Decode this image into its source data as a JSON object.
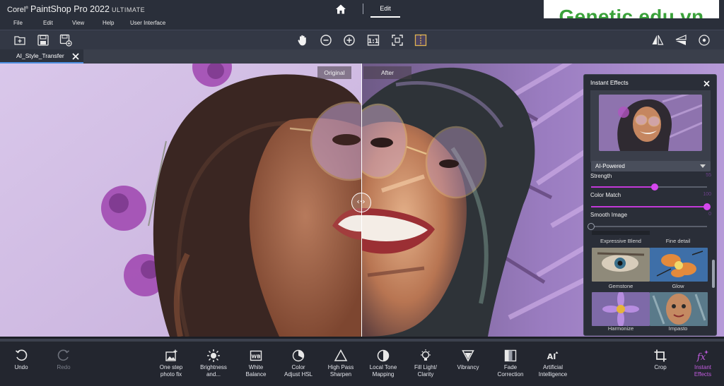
{
  "app": {
    "brand": "Corel",
    "product": "PaintShop Pro 2022",
    "edition": "ULTIMATE",
    "mode_tab": "Edit"
  },
  "watermark": "Genetic.edu.vn",
  "menu": [
    "File",
    "Edit",
    "View",
    "Help",
    "User Interface"
  ],
  "toolbar": {
    "left_icons": [
      "new-file-icon",
      "save-icon",
      "save-as-icon"
    ],
    "center_icons": [
      "pan-hand-icon",
      "zoom-out-icon",
      "zoom-in-icon",
      "actual-size-icon",
      "fit-to-window-icon",
      "compare-split-icon"
    ],
    "right_icons": [
      "flip-horizontal-icon",
      "flip-vertical-icon",
      "more-options-icon"
    ]
  },
  "document_tab": {
    "name": "AI_Style_Transfer"
  },
  "compare": {
    "original_label": "Original",
    "after_label": "After",
    "handle_glyph": "‹·›"
  },
  "panel": {
    "title": "Instant Effects",
    "dropdown": "AI-Powered",
    "sliders": [
      {
        "label": "Strength",
        "value": 55,
        "max": 100
      },
      {
        "label": "Color Match",
        "value": 100,
        "max": 100
      },
      {
        "label": "Smooth Image",
        "value": 0,
        "max": 100
      }
    ],
    "effects": [
      "Expressive Blend",
      "Fine detail",
      "Gemstone",
      "Glow",
      "Harmonize",
      "Impasto"
    ]
  },
  "dock": [
    {
      "label": "Undo",
      "icon": "undo-icon",
      "enabled": true
    },
    {
      "label": "Redo",
      "icon": "redo-icon",
      "enabled": false
    },
    {
      "label": "One step\nphoto fix",
      "icon": "one-step-fix-icon",
      "enabled": true
    },
    {
      "label": "Brightness\nand...",
      "icon": "brightness-icon",
      "enabled": true
    },
    {
      "label": "White\nBalance",
      "icon": "white-balance-icon",
      "enabled": true
    },
    {
      "label": "Color\nAdjust HSL",
      "icon": "color-hsl-icon",
      "enabled": true
    },
    {
      "label": "High Pass\nSharpen",
      "icon": "high-pass-icon",
      "enabled": true
    },
    {
      "label": "Local Tone\nMapping",
      "icon": "tone-mapping-icon",
      "enabled": true
    },
    {
      "label": "Fill Light/\nClarity",
      "icon": "fill-light-icon",
      "enabled": true
    },
    {
      "label": "Vibrancy",
      "icon": "vibrancy-icon",
      "enabled": true
    },
    {
      "label": "Fade\nCorrection",
      "icon": "fade-correction-icon",
      "enabled": true
    },
    {
      "label": "Artificial\nIntelligence",
      "icon": "ai-icon",
      "enabled": true
    },
    {
      "label": "Crop",
      "icon": "crop-icon",
      "enabled": true
    },
    {
      "label": "Instant\nEffects",
      "icon": "instant-effects-icon",
      "enabled": true,
      "active": true
    }
  ],
  "colors": {
    "accent": "#c339d9",
    "tab_underline": "#4d8fe0",
    "watermark_text": "#3aa13a"
  }
}
